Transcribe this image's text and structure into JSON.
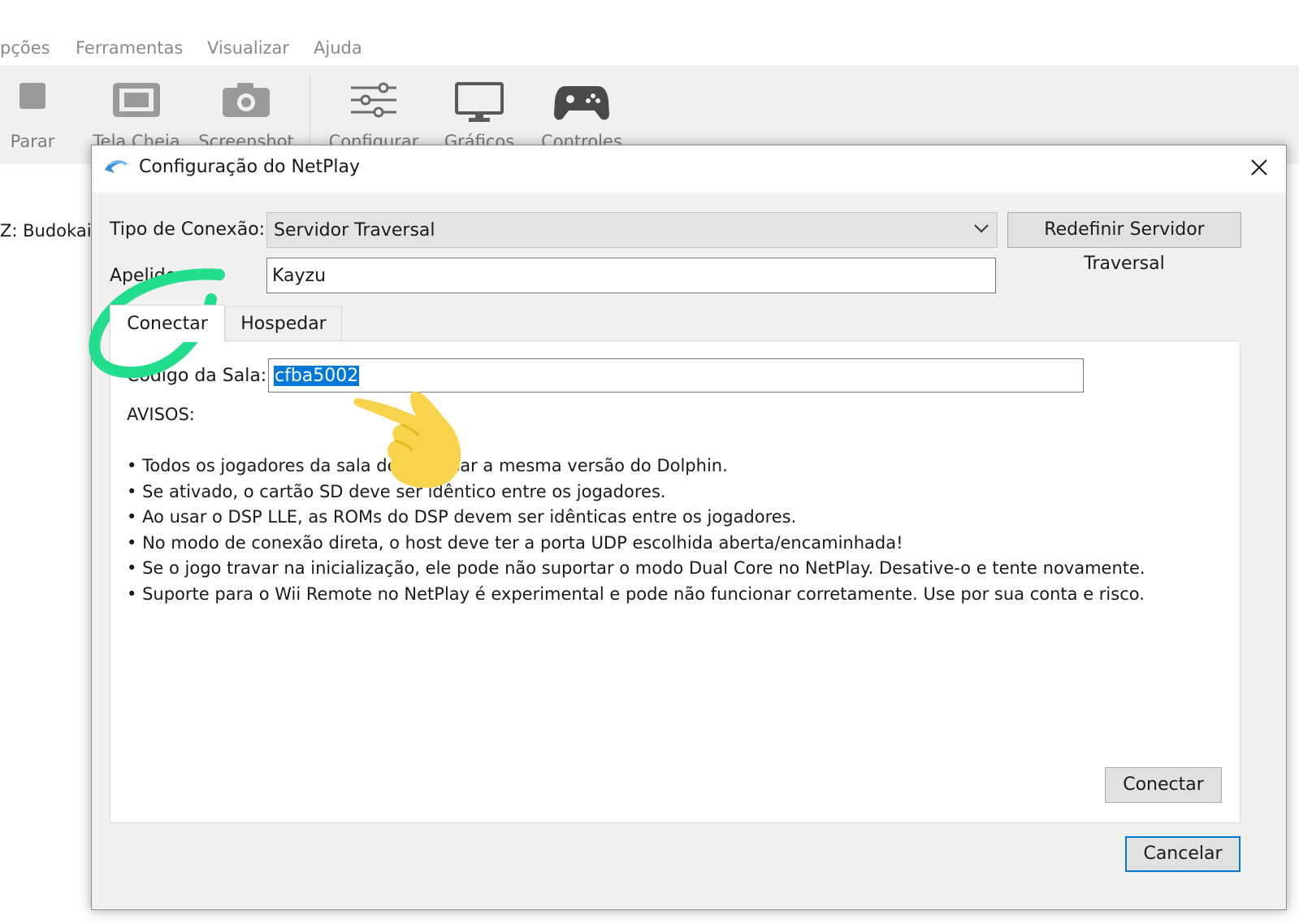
{
  "menu": [
    "pções",
    "Ferramentas",
    "Visualizar",
    "Ajuda"
  ],
  "toolbar": {
    "stop": "Parar",
    "fullscreen": "Tela Cheia",
    "screenshot": "Screenshot",
    "config": "Configurar",
    "graphics": "Gráficos",
    "controllers": "Controles"
  },
  "background": {
    "game_title_fragment": "Z: Budokai"
  },
  "dialog": {
    "title": "Configuração do NetPlay",
    "connection_type_label": "Tipo de Conexão:",
    "connection_type_value": "Servidor Traversal",
    "reset_traversal_button": "Redefinir Servidor Traversal",
    "nickname_label": "Apelido:",
    "nickname_value": "Kayzu",
    "tabs": [
      "Conectar",
      "Hospedar"
    ],
    "room_code_label": "Código da Sala:",
    "room_code_value": "cfba5002",
    "warnings_title": "AVISOS:",
    "warnings": [
      "Todos os jogadores da sala devem usar a mesma versão do Dolphin.",
      "Se ativado, o cartão SD deve ser idêntico entre os jogadores.",
      "Ao usar o DSP LLE, as ROMs do DSP devem ser idênticas entre os jogadores.",
      "No modo de conexão direta, o host deve ter a porta UDP escolhida aberta/encaminhada!",
      "Se o jogo travar na inicialização, ele pode não suportar o modo Dual Core no NetPlay. Desative-o e tente novamente.",
      "Suporte para o Wii Remote no NetPlay é experimental e pode não funcionar corretamente. Use por sua conta e risco."
    ],
    "connect_button": "Conectar",
    "cancel_button": "Cancelar"
  },
  "colors": {
    "selection": "#0078d7",
    "annotation_circle": "#22dd8c",
    "annotation_hand": "#f7d44c",
    "default_button_border": "#0078d7"
  },
  "icons": [
    "dolphin-icon",
    "close-icon",
    "chevron-down-icon",
    "stop-icon",
    "fullscreen-icon",
    "camera-icon",
    "sliders-icon",
    "monitor-icon",
    "gamepad-icon",
    "pointing-hand-icon"
  ]
}
